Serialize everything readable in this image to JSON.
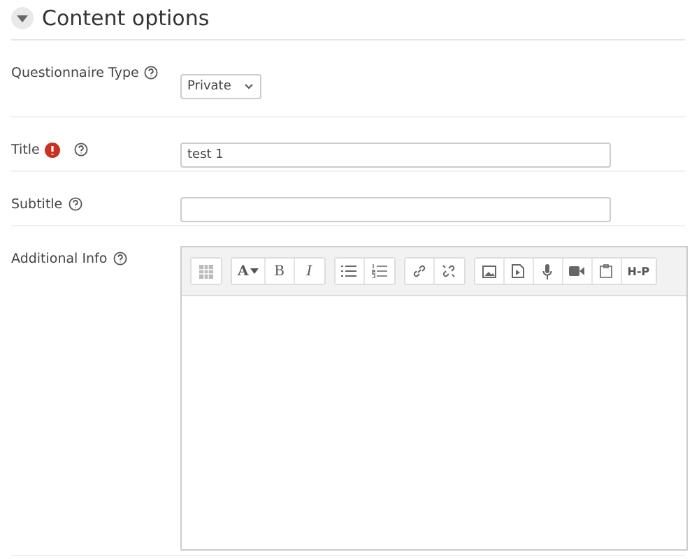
{
  "section": {
    "title": "Content options",
    "expanded": true
  },
  "fields": [
    {
      "label": "Questionnaire Type",
      "kind": "select",
      "value": "Private",
      "required": false
    },
    {
      "label": "Title",
      "kind": "text",
      "value": "test 1",
      "required": true
    },
    {
      "label": "Subtitle",
      "kind": "text",
      "required": false
    },
    {
      "label": "Additional Info",
      "kind": "editor",
      "required": false
    }
  ],
  "toolbar": [
    [
      {
        "kind": "table"
      }
    ],
    [
      {
        "kind": "font",
        "text": "A"
      },
      {
        "kind": "text",
        "text": "B"
      },
      {
        "kind": "italic",
        "text": "I"
      }
    ],
    [
      {
        "kind": "bullets"
      },
      {
        "kind": "numbers"
      }
    ],
    [
      {
        "kind": "link"
      },
      {
        "kind": "unlink"
      }
    ],
    [
      {
        "kind": "image"
      },
      {
        "kind": "media"
      },
      {
        "kind": "mic"
      },
      {
        "kind": "video"
      },
      {
        "kind": "paste"
      },
      {
        "kind": "h5p",
        "text": "H-P"
      }
    ]
  ]
}
